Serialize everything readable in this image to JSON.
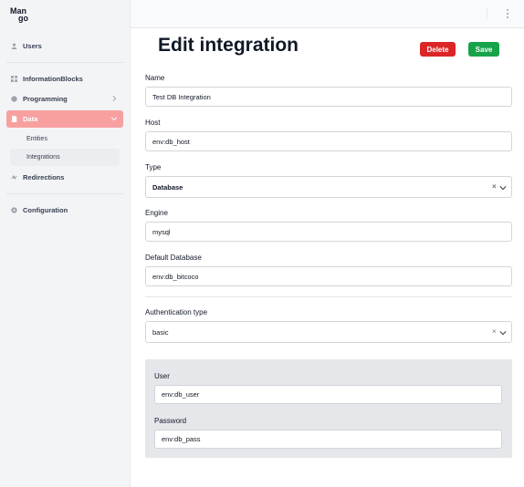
{
  "logo": {
    "line1": "Man",
    "line2": "go"
  },
  "sidebar": {
    "items": [
      {
        "label": "Users",
        "icon": "user-icon"
      },
      {
        "label": "InformationBlocks",
        "icon": "grid-icon"
      },
      {
        "label": "Programming",
        "icon": "code-icon"
      },
      {
        "label": "Data",
        "icon": "document-icon",
        "active": true
      },
      {
        "label": "Redirections",
        "icon": "redirect-icon"
      },
      {
        "label": "Configuration",
        "icon": "gear-icon"
      }
    ],
    "sub_items": [
      {
        "label": "Entities"
      },
      {
        "label": "Integrations",
        "active": true
      }
    ]
  },
  "page": {
    "title": "Edit integration",
    "delete_label": "Delete",
    "save_label": "Save"
  },
  "form": {
    "name_label": "Name",
    "name_value": "Test DB Integration",
    "host_label": "Host",
    "host_value": "env:db_host",
    "type_label": "Type",
    "type_value": "Database",
    "engine_label": "Engine",
    "engine_value": "mysql",
    "default_db_label": "Default Database",
    "default_db_value": "env:db_bitcoco",
    "auth_type_label": "Authentication type",
    "auth_type_value": "basic",
    "user_label": "User",
    "user_value": "env:db_user",
    "password_label": "Password",
    "password_value": "env:db_pass",
    "clear_glyph": "×"
  },
  "colors": {
    "accent_active": "#f8a0a0",
    "delete": "#dc2626",
    "save": "#16a34a"
  }
}
